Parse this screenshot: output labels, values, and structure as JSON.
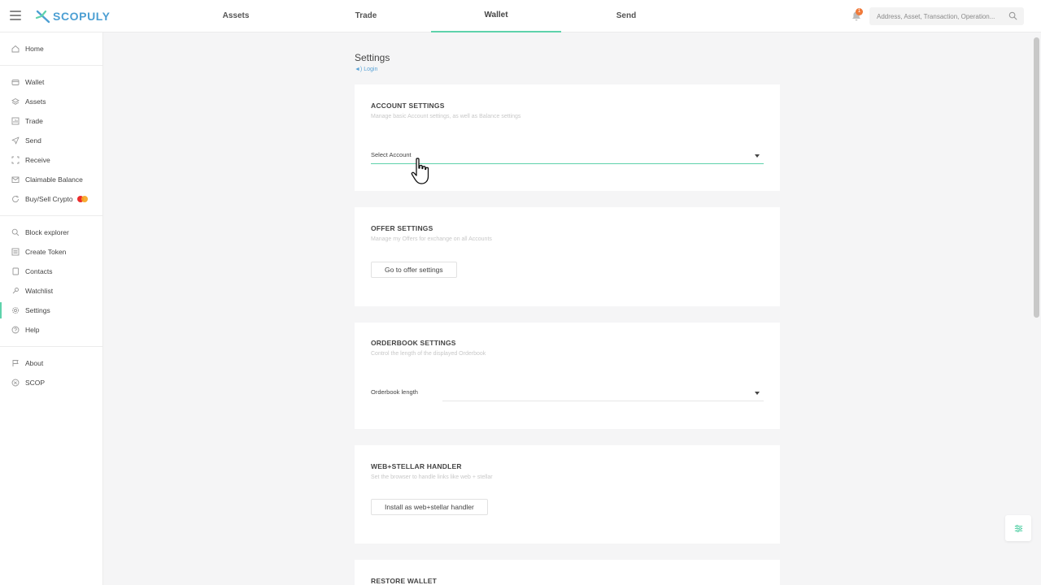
{
  "brand": {
    "name": "SCOPULY",
    "color": "#4c9fd3",
    "accent": "#5ed2ab"
  },
  "nav": {
    "tabs": [
      {
        "label": "Assets"
      },
      {
        "label": "Trade"
      },
      {
        "label": "Wallet",
        "active": true
      },
      {
        "label": "Send"
      }
    ]
  },
  "notifications": {
    "count": "1"
  },
  "search": {
    "placeholder": "Address, Asset, Transaction, Operation..."
  },
  "sidebar": {
    "groups": [
      [
        {
          "label": "Home",
          "icon": "home-icon"
        }
      ],
      [
        {
          "label": "Wallet",
          "icon": "wallet-icon"
        },
        {
          "label": "Assets",
          "icon": "layers-icon"
        },
        {
          "label": "Trade",
          "icon": "chart-icon"
        },
        {
          "label": "Send",
          "icon": "send-icon"
        },
        {
          "label": "Receive",
          "icon": "qr-icon"
        },
        {
          "label": "Claimable Balance",
          "icon": "envelope-icon"
        },
        {
          "label": "Buy/Sell Crypto",
          "icon": "refresh-icon"
        }
      ],
      [
        {
          "label": "Block explorer",
          "icon": "search-icon"
        },
        {
          "label": "Create Token",
          "icon": "list-icon"
        },
        {
          "label": "Contacts",
          "icon": "book-icon"
        },
        {
          "label": "Watchlist",
          "icon": "eye-icon"
        },
        {
          "label": "Settings",
          "icon": "gear-icon",
          "active": true
        },
        {
          "label": "Help",
          "icon": "help-icon"
        }
      ],
      [
        {
          "label": "About",
          "icon": "flag-icon"
        },
        {
          "label": "SCOP",
          "icon": "scop-icon"
        }
      ]
    ]
  },
  "page": {
    "title": "Settings",
    "login": "Login"
  },
  "cards": {
    "account": {
      "title": "ACCOUNT SETTINGS",
      "subtitle": "Manage basic Account settings, as well as Balance settings",
      "select_label": "Select Account"
    },
    "offer": {
      "title": "OFFER SETTINGS",
      "subtitle": "Manage my Offers for exchange on all Accounts",
      "button": "Go to offer settings"
    },
    "orderbook": {
      "title": "ORDERBOOK SETTINGS",
      "subtitle": "Control the length of the displayed Orderbook",
      "select_label": "Orderbook length"
    },
    "handler": {
      "title": "WEB+STELLAR HANDLER",
      "subtitle": "Set the browser to handle links like web + stellar",
      "button": "Install as web+stellar handler"
    },
    "restore": {
      "title": "RESTORE WALLET"
    }
  }
}
